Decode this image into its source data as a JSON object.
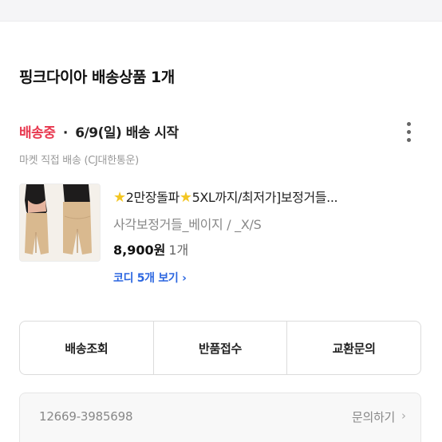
{
  "section_title": "핑크다이아 배송상품 1개",
  "shipment": {
    "status": "배송중",
    "separator": "·",
    "date_text": "6/9(일) 배송 시작",
    "method": "마켓 직접 배송 (CJ대한통운)"
  },
  "more_icon": "more-vertical-icon",
  "product": {
    "image_icon": "product-thumbnail",
    "name_part1": "2만장돌파",
    "name_part2": "5XL까지/최저가]보정거들...",
    "star_icon": "star-icon",
    "option": "사각보정거들_베이지 / _X/S",
    "price": "8,900원",
    "quantity": "1개",
    "coordi_link": "코디 5개 보기",
    "coordi_chevron": "›"
  },
  "actions": {
    "track": "배송조회",
    "return": "반품접수",
    "exchange": "교환문의"
  },
  "inquiry": {
    "order_number": "12669-3985698",
    "link_label": "문의하기",
    "chevron": "›"
  },
  "colors": {
    "status_red": "#e8384f",
    "link_blue": "#2b66e0",
    "star_yellow": "#f3c623"
  }
}
